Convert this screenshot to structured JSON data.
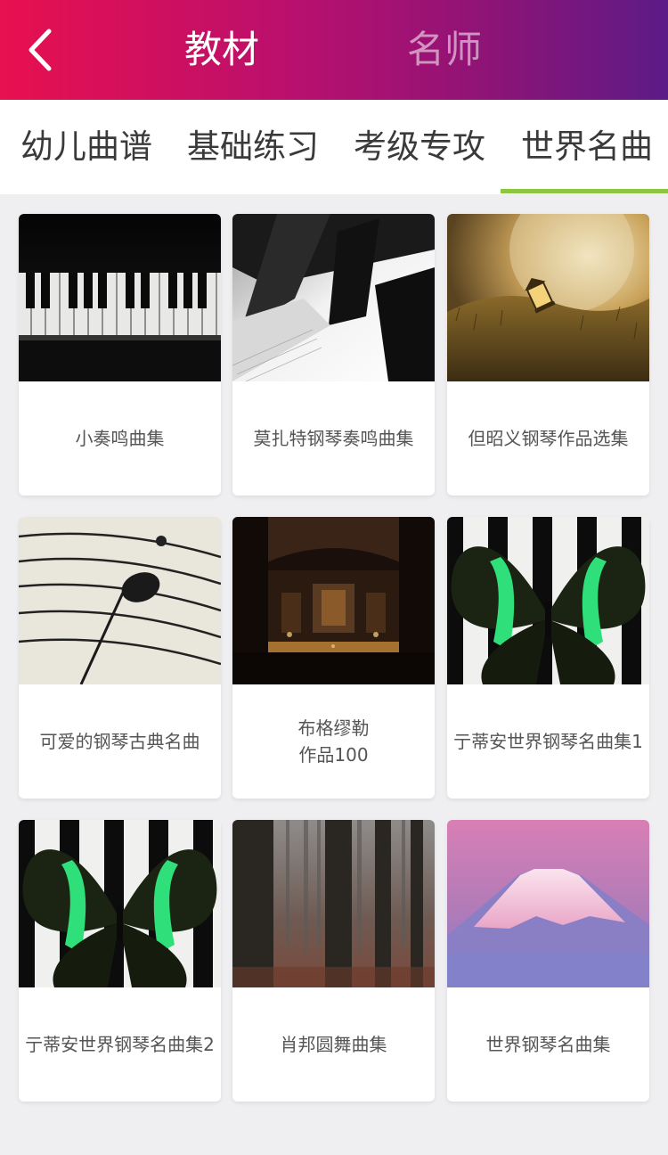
{
  "header": {
    "back_icon": "chevron-left-icon",
    "tabs": [
      {
        "label": "教材",
        "active": true
      },
      {
        "label": "名师",
        "active": false
      }
    ],
    "colors": {
      "start": "#e8104f",
      "end": "#5c1b87"
    }
  },
  "categories": [
    {
      "label": "幼儿曲谱",
      "active": false
    },
    {
      "label": "基础练习",
      "active": false
    },
    {
      "label": "考级专攻",
      "active": false
    },
    {
      "label": "世界名曲",
      "active": true
    }
  ],
  "accent_color": "#8dc63f",
  "books": [
    {
      "title": "小奏鸣曲集",
      "image": "piano-keys-photo"
    },
    {
      "title": "莫扎特钢琴奏鸣曲集",
      "image": "piano-keys-closeup-photo"
    },
    {
      "title": "但昭义钢琴作品选集",
      "image": "lantern-field-photo"
    },
    {
      "title": "可爱的钢琴古典名曲",
      "image": "music-note-staff-photo"
    },
    {
      "title": "布格缪勒\n作品100",
      "image": "library-hall-photo"
    },
    {
      "title": "亍蒂安世界钢琴名曲集1",
      "image": "butterfly-piano-photo"
    },
    {
      "title": "亍蒂安世界钢琴名曲集2",
      "image": "butterfly-piano-photo"
    },
    {
      "title": "肖邦圆舞曲集",
      "image": "misty-forest-photo"
    },
    {
      "title": "世界钢琴名曲集",
      "image": "mount-fuji-photo"
    }
  ]
}
